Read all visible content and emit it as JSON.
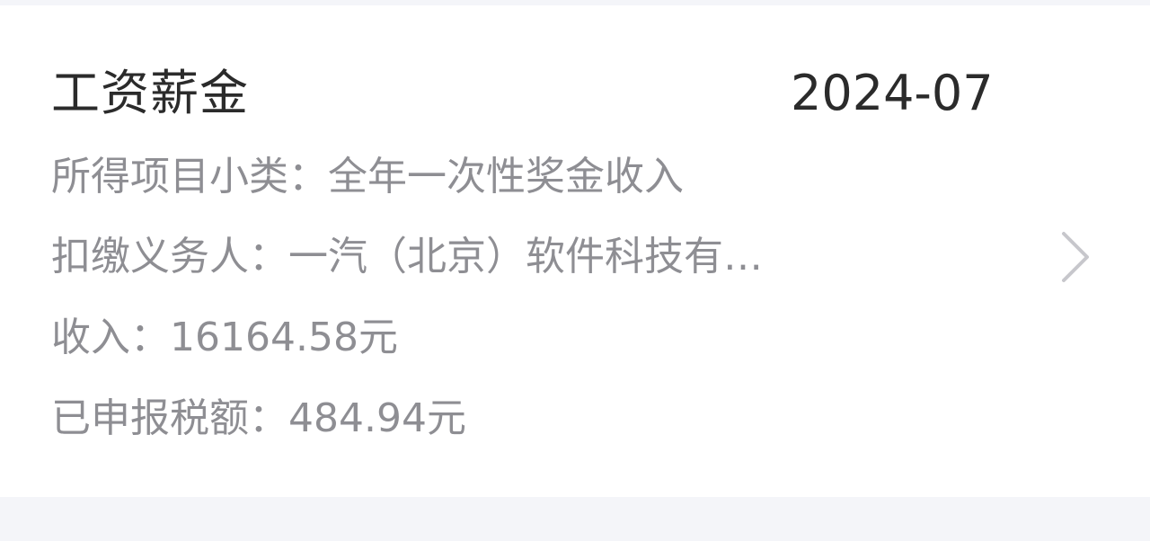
{
  "record": {
    "title": "工资薪金",
    "period": "2024-07",
    "subcategory": {
      "label": "所得项目小类：",
      "value": "全年一次性奖金收入"
    },
    "withholder": {
      "label": "扣缴义务人：",
      "value": "一汽（北京）软件科技有…"
    },
    "income": {
      "label": "收入：",
      "value": "16164.58元"
    },
    "tax": {
      "label": "已申报税额：",
      "value": "484.94元"
    }
  },
  "icons": {
    "chevron": "chevron-right-icon"
  },
  "colors": {
    "title": "#2b2b2b",
    "secondary_text": "#8e8e93",
    "background": "#f4f5f9",
    "card": "#ffffff",
    "chevron": "#c7c7cc"
  }
}
